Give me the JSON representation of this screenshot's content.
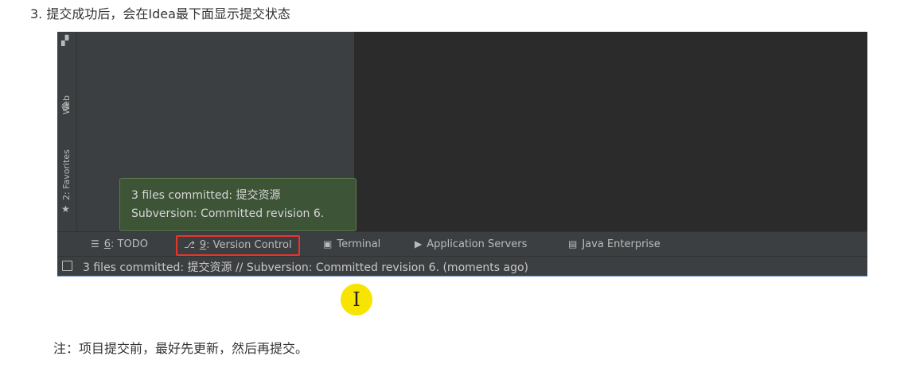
{
  "heading": "3. 提交成功后，会在Idea最下面显示提交状态",
  "ide": {
    "side_tabs": {
      "web": "Web",
      "favorites": "2: Favorites"
    },
    "tooltip": {
      "line1": "3 files committed: 提交资源",
      "line2": "Subversion: Committed revision 6."
    },
    "tool_windows": [
      {
        "number": "6",
        "label": ": TODO",
        "icon": "list-icon"
      },
      {
        "number": "9",
        "label": ": Version Control",
        "icon": "branch-icon",
        "highlighted": true
      },
      {
        "label": "Terminal",
        "icon": "terminal-icon"
      },
      {
        "label": "Application Servers",
        "icon": "servers-icon"
      },
      {
        "label": "Java Enterprise",
        "icon": "java-enterprise-icon"
      }
    ],
    "status": "3 files committed: 提交资源 // Subversion: Committed revision 6. (moments ago)"
  },
  "cursor_glyph": "I",
  "note": "注：项目提交前，最好先更新，然后再提交。",
  "colors": {
    "highlight_border": "#e8352c",
    "tooltip_bg": "#3d5437",
    "cursor_highlight": "#f7e400",
    "ide_panel": "#3c3f41",
    "ide_editor": "#2b2b2b"
  }
}
